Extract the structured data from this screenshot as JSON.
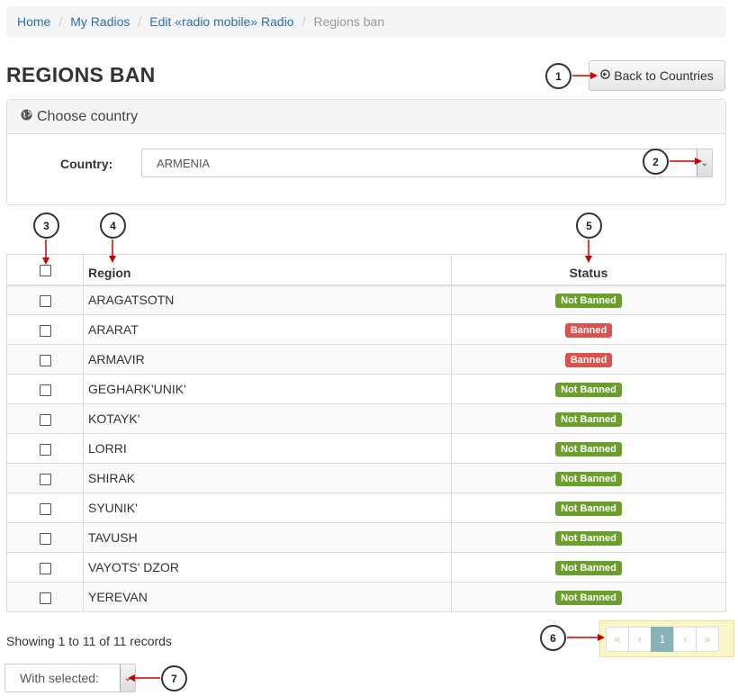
{
  "breadcrumb": {
    "items": [
      "Home",
      "My Radios",
      "Edit «radio mobile» Radio"
    ],
    "current": "Regions ban"
  },
  "page": {
    "title": "REGIONS BAN"
  },
  "back_button": {
    "label": "Back to Countries",
    "icon": "circle-arrow-left-icon"
  },
  "panel": {
    "heading": "Choose country",
    "heading_icon": "globe-icon",
    "country_label": "Country:",
    "country_value": "ARMENIA"
  },
  "table": {
    "headers": {
      "region": "Region",
      "status": "Status"
    },
    "rows": [
      {
        "region": "ARAGATSOTN",
        "status": "Not Banned",
        "banned": false
      },
      {
        "region": "ARARAT",
        "status": "Banned",
        "banned": true
      },
      {
        "region": "ARMAVIR",
        "status": "Banned",
        "banned": true
      },
      {
        "region": "GEGHARK'UNIK'",
        "status": "Not Banned",
        "banned": false
      },
      {
        "region": "KOTAYK'",
        "status": "Not Banned",
        "banned": false
      },
      {
        "region": "LORRI",
        "status": "Not Banned",
        "banned": false
      },
      {
        "region": "SHIRAK",
        "status": "Not Banned",
        "banned": false
      },
      {
        "region": "SYUNIK'",
        "status": "Not Banned",
        "banned": false
      },
      {
        "region": "TAVUSH",
        "status": "Not Banned",
        "banned": false
      },
      {
        "region": "VAYOTS' DZOR",
        "status": "Not Banned",
        "banned": false
      },
      {
        "region": "YEREVAN",
        "status": "Not Banned",
        "banned": false
      }
    ]
  },
  "footer": {
    "records_text": "Showing 1 to 11 of 11 records",
    "pagination": [
      "«",
      "‹",
      "1",
      "›",
      "»"
    ],
    "current_page": "1",
    "with_selected": "With selected:"
  },
  "annotations": [
    "1",
    "2",
    "3",
    "4",
    "5",
    "6",
    "7"
  ],
  "colors": {
    "not_banned": "#6a9f2c",
    "banned": "#d9534f",
    "link": "#2a6fb0",
    "annotation_arrow": "#cc0000",
    "pager_highlight": "#fbf6c8"
  }
}
